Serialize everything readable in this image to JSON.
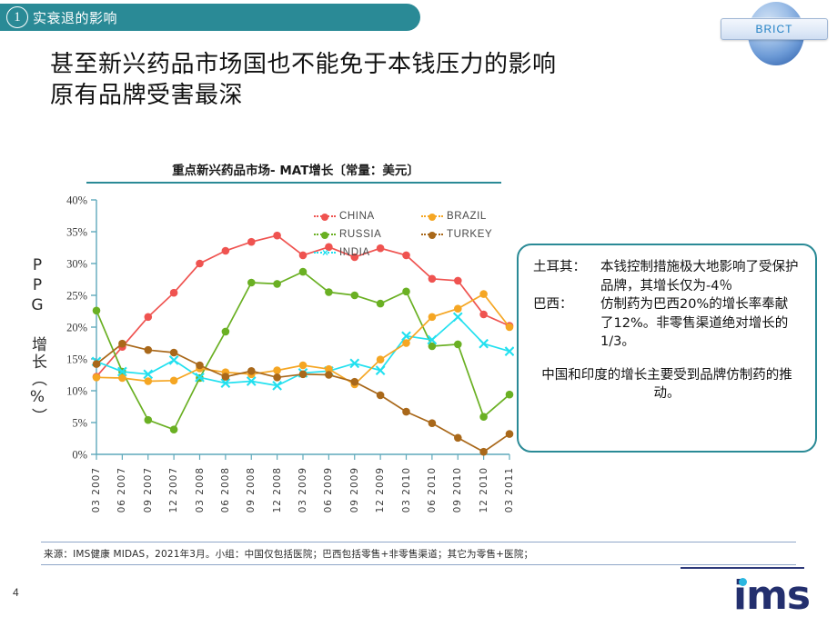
{
  "header": {
    "step_number": "1",
    "banner_text": "实衰退的影响",
    "brict_label": "BRICT",
    "globe_icon": "globe-icon"
  },
  "title": {
    "line1": "甚至新兴药品市场国也不能免于本钱压力的影响",
    "line2": "原有品牌受害最深"
  },
  "chart_data": {
    "type": "line",
    "title": "重点新兴药品市场- MAT增长〔常量：美元〕",
    "xlabel": "",
    "ylabel": "PPG 增长（%）",
    "ylim": [
      0,
      40
    ],
    "yticks": [
      "0%",
      "5%",
      "10%",
      "15%",
      "20%",
      "25%",
      "30%",
      "35%",
      "40%"
    ],
    "ytick_values": [
      0,
      5,
      10,
      15,
      20,
      25,
      30,
      35,
      40
    ],
    "grid": false,
    "legend_position": "upper-right-inside",
    "categories": [
      "03 2007",
      "06 2007",
      "09 2007",
      "12 2007",
      "03 2008",
      "06 2008",
      "09 2008",
      "12 2008",
      "03 2009",
      "06 2009",
      "09 2009",
      "12 2009",
      "03 2010",
      "06 2010",
      "09 2010",
      "12 2010",
      "03 2011"
    ],
    "series": [
      {
        "name": "CHINA",
        "color": "#ef5350",
        "marker": "circle",
        "values": [
          12.2,
          16.9,
          21.6,
          25.4,
          30.0,
          32.0,
          33.4,
          34.4,
          31.3,
          32.6,
          31.0,
          32.4,
          31.3,
          27.6,
          27.3,
          22.0,
          20.2
        ]
      },
      {
        "name": "RUSSIA",
        "color": "#6ab023",
        "marker": "circle",
        "values": [
          22.6,
          13.0,
          5.4,
          3.9,
          12.0,
          19.3,
          27.0,
          26.8,
          28.7,
          25.5,
          25.0,
          23.7,
          25.6,
          17.0,
          17.3,
          5.9,
          9.4
        ]
      },
      {
        "name": "INDIA",
        "color": "#22e0ef",
        "marker": "x",
        "values": [
          14.6,
          13.0,
          12.6,
          14.8,
          12.1,
          11.2,
          11.5,
          10.8,
          12.8,
          13.1,
          14.3,
          13.2,
          18.6,
          18.0,
          21.6,
          17.4,
          16.2
        ]
      },
      {
        "name": "BRAZIL",
        "color": "#f5a623",
        "marker": "circle",
        "values": [
          12.1,
          12.0,
          11.5,
          11.6,
          13.5,
          12.9,
          12.6,
          13.2,
          14.0,
          13.4,
          11.0,
          14.9,
          17.5,
          21.6,
          22.9,
          25.2,
          20.0
        ]
      },
      {
        "name": "TURKEY",
        "color": "#a9681a",
        "marker": "circle",
        "values": [
          14.2,
          17.4,
          16.4,
          16.0,
          14.0,
          12.2,
          13.1,
          12.1,
          12.6,
          12.5,
          11.4,
          9.3,
          6.7,
          4.9,
          2.6,
          0.4,
          3.2
        ]
      }
    ]
  },
  "callout": {
    "rows": [
      {
        "label": "土耳其：",
        "body": "本钱控制措施极大地影响了受保护品牌，其增长仅为-4％"
      },
      {
        "label": "巴西：",
        "body": "仿制药为巴西20%的增长率奉献了12%。非零售渠道绝对增长的1/3。"
      }
    ],
    "paragraph": "中国和印度的增长主要受到品牌仿制药的推动。"
  },
  "footer": {
    "source": "来源：IMS健康 MIDAS，2021年3月。小组：中国仅包括医院；巴西包括零售+非零售渠道；其它为零售+医院；",
    "page_number": "4",
    "logo_text": "ims"
  },
  "colors": {
    "teal": "#2a8a96",
    "brand_navy": "#232f6e",
    "accent_cyan": "#2ab6e0"
  }
}
